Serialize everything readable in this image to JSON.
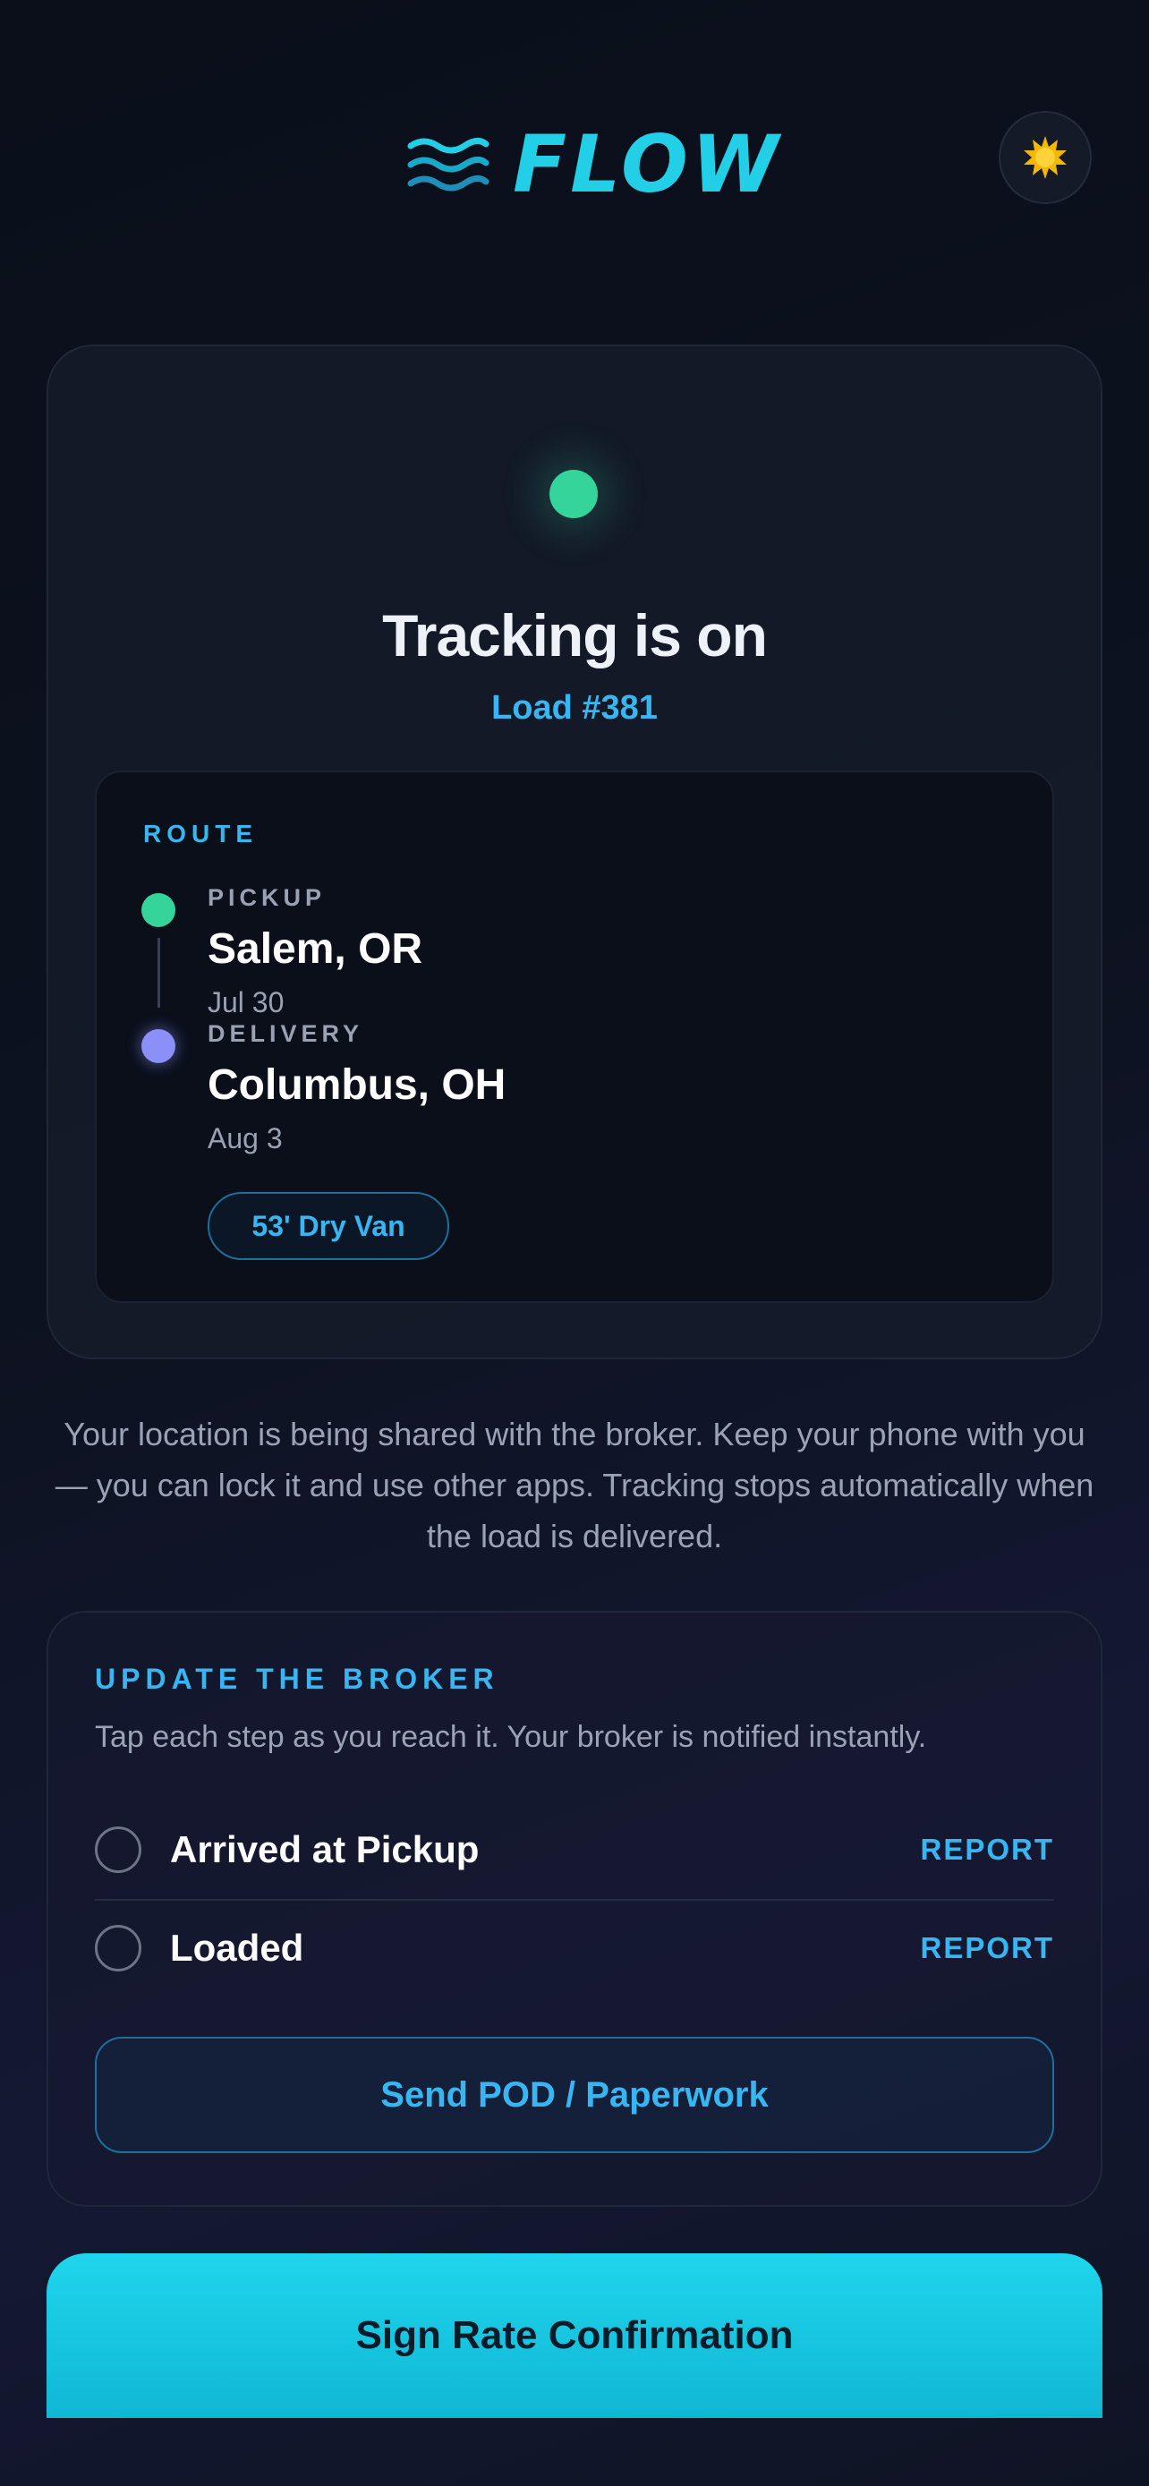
{
  "header": {
    "brand": "FLOW",
    "logo_icon": "waves-icon",
    "theme_toggle_icon": "sun-icon"
  },
  "tracking": {
    "title": "Tracking is on",
    "load": "Load #381",
    "status_color": "#35d49a"
  },
  "route": {
    "label": "ROUTE",
    "pickup": {
      "type": "PICKUP",
      "city": "Salem, OR",
      "date": "Jul 30"
    },
    "delivery": {
      "type": "DELIVERY",
      "city": "Columbus, OH",
      "date": "Aug 3"
    },
    "equipment": "53' Dry Van"
  },
  "info": "Your location is being shared with the broker. Keep your phone with you — you can lock it and use other apps. Tracking stops automatically when the load is delivered.",
  "update": {
    "title": "UPDATE THE BROKER",
    "subtitle": "Tap each step as you reach it. Your broker is notified instantly.",
    "steps": [
      {
        "label": "Arrived at Pickup",
        "action": "REPORT"
      },
      {
        "label": "Loaded",
        "action": "REPORT"
      }
    ],
    "pod_button": "Send POD / Paperwork"
  },
  "primary_action": "Sign Rate Confirmation",
  "colors": {
    "accent": "#38b6f1",
    "brand": "#22cfe6",
    "pickup": "#35d49a",
    "delivery": "#8b8ff7"
  }
}
